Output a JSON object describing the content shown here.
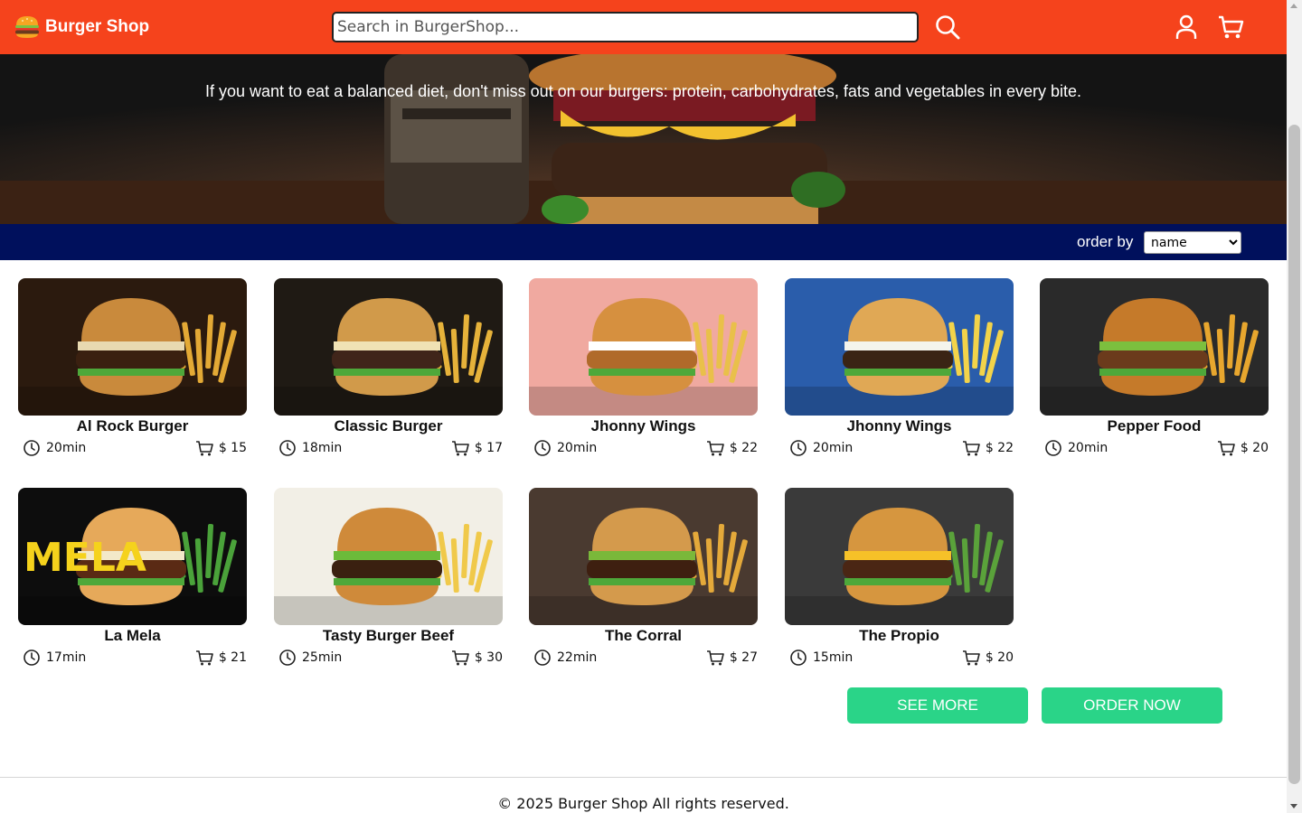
{
  "header": {
    "brand_name": "Burger Shop",
    "search_placeholder": "Search in BurgerShop...",
    "search_value": ""
  },
  "hero": {
    "tagline": "If you want to eat a balanced diet, don't miss out on our burgers: protein, carbohydrates, fats and vegetables in every bite."
  },
  "sort": {
    "label": "order by",
    "selected": "name",
    "options": [
      "name"
    ]
  },
  "products": [
    {
      "name": "Al Rock Burger",
      "time": "20min",
      "price": "$ 15"
    },
    {
      "name": "Classic Burger",
      "time": "18min",
      "price": "$ 17"
    },
    {
      "name": "Jhonny Wings",
      "time": "20min",
      "price": "$ 22"
    },
    {
      "name": "Jhonny Wings",
      "time": "20min",
      "price": "$ 22"
    },
    {
      "name": "Pepper Food",
      "time": "20min",
      "price": "$ 20"
    },
    {
      "name": "La Mela",
      "time": "17min",
      "price": "$ 21",
      "image_text": "MELA"
    },
    {
      "name": "Tasty Burger Beef",
      "time": "25min",
      "price": "$ 30"
    },
    {
      "name": "The Corral",
      "time": "22min",
      "price": "$ 27"
    },
    {
      "name": "The Propio",
      "time": "15min",
      "price": "$ 20"
    }
  ],
  "actions": {
    "see_more": "SEE MORE",
    "order_now": "ORDER NOW"
  },
  "footer": {
    "text": "© 2025 Burger Shop All rights reserved."
  },
  "colors": {
    "header": "#f5431c",
    "sortbar": "#00105c",
    "button": "#2ad488"
  }
}
